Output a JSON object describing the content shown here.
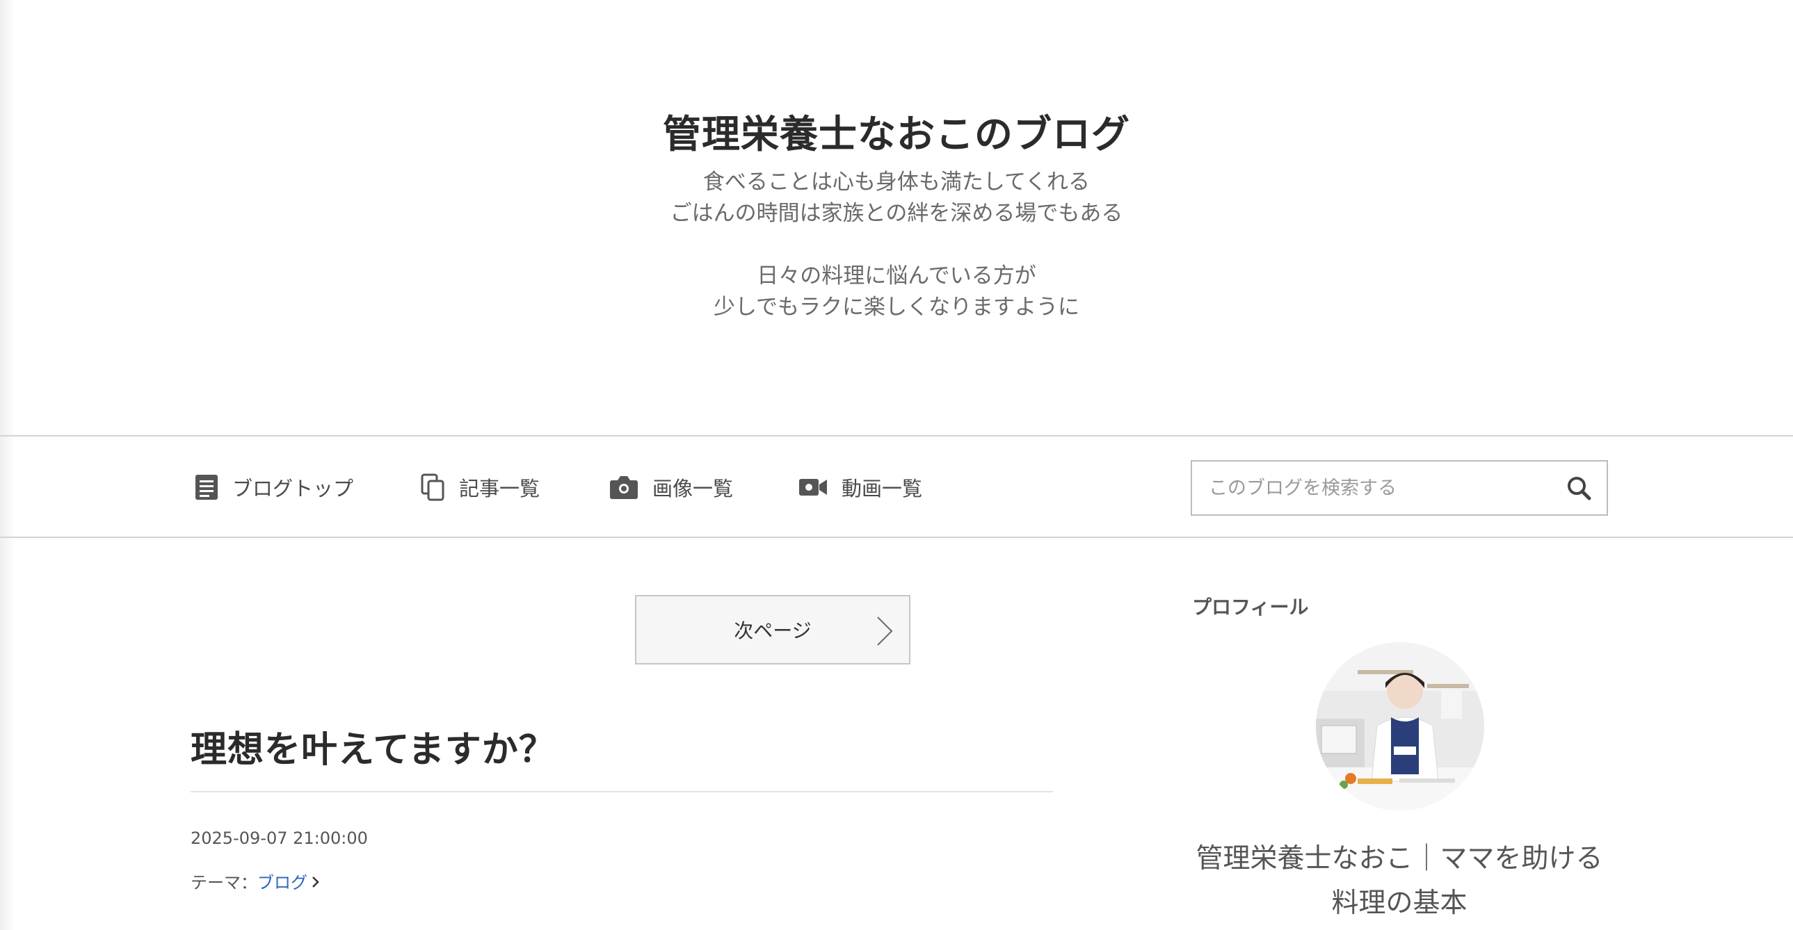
{
  "header": {
    "title": "管理栄養士なおこのブログ",
    "description_lines": [
      "食べることは心も身体も満たしてくれる",
      "ごはんの時間は家族との絆を深める場でもある",
      "",
      "日々の料理に悩んでいる方が",
      "少しでもラクに楽しくなりますように"
    ]
  },
  "nav": {
    "items": [
      {
        "label": "ブログトップ",
        "icon": "document-icon"
      },
      {
        "label": "記事一覧",
        "icon": "copy-icon"
      },
      {
        "label": "画像一覧",
        "icon": "camera-icon"
      },
      {
        "label": "動画一覧",
        "icon": "video-icon"
      }
    ],
    "search": {
      "placeholder": "このブログを検索する",
      "icon": "search-icon"
    }
  },
  "main": {
    "next_page_label": "次ページ",
    "article": {
      "title": "理想を叶えてますか？",
      "date": "2025-09-07 21:00:00",
      "theme_label": "テーマ：",
      "theme_value": "ブログ"
    }
  },
  "sidebar": {
    "profile_heading": "プロフィール",
    "profile_name_lines": [
      "管理栄養士なおこ｜ママを助ける",
      "料理の基本"
    ]
  },
  "colors": {
    "link": "#2a66b8",
    "text": "#333333",
    "muted": "#6a6a6a",
    "border": "#d4d4d4"
  }
}
